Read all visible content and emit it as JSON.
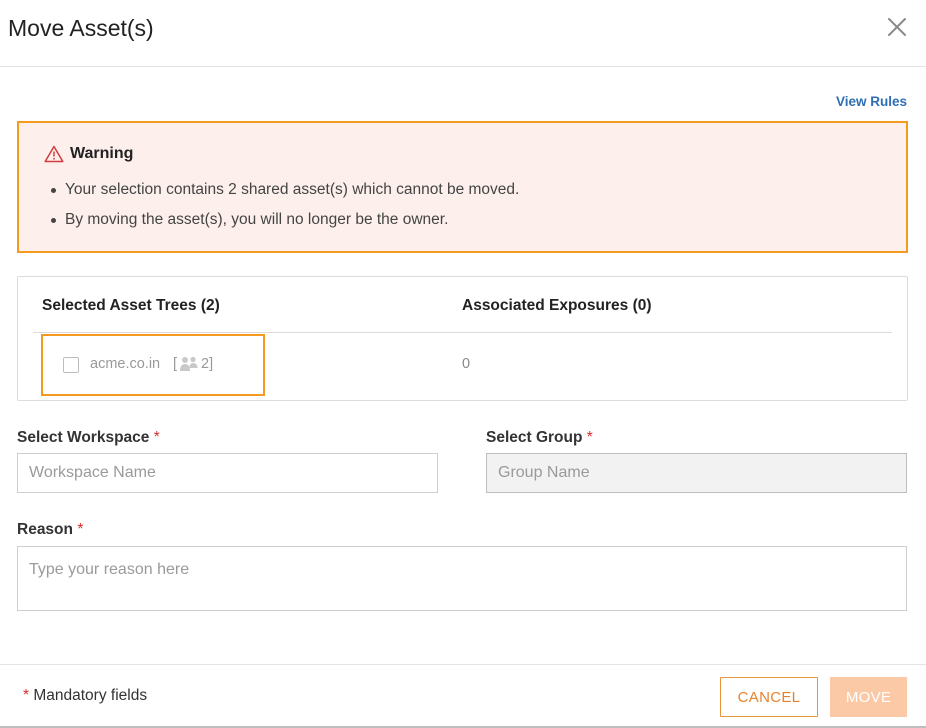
{
  "dialog": {
    "title": "Move Asset(s)",
    "close_icon": "close-icon"
  },
  "links": {
    "view_rules": "View Rules"
  },
  "warning": {
    "icon": "warning-triangle-icon",
    "title": "Warning",
    "messages": [
      "Your selection contains 2 shared asset(s) which cannot be moved.",
      "By moving the asset(s), you will no longer be the owner."
    ]
  },
  "asset_table": {
    "columns": [
      "Selected Asset Trees (2)",
      "Associated Exposures (0)"
    ],
    "rows": [
      {
        "name": "acme.co.in",
        "shared_icon": "users-icon",
        "shared_open": "[",
        "shared_count": "2]",
        "exposures": "0",
        "checked": false
      }
    ]
  },
  "form": {
    "workspace": {
      "label": "Select Workspace",
      "required_mark": "*",
      "placeholder": "Workspace Name",
      "value": ""
    },
    "group": {
      "label": "Select Group",
      "required_mark": "*",
      "placeholder": "Group Name",
      "value": ""
    },
    "reason": {
      "label": "Reason",
      "required_mark": "*",
      "placeholder": "Type your reason here",
      "value": ""
    }
  },
  "footer": {
    "mandatory_mark": "*",
    "mandatory_text": "Mandatory fields",
    "cancel_label": "CANCEL",
    "move_label": "MOVE"
  },
  "colors": {
    "accent_orange": "#f39a1f",
    "warning_bg": "#fdf0ec",
    "link_blue": "#2f6fb3",
    "required_red": "#d92b2b",
    "move_disabled": "#fbc9a5"
  }
}
